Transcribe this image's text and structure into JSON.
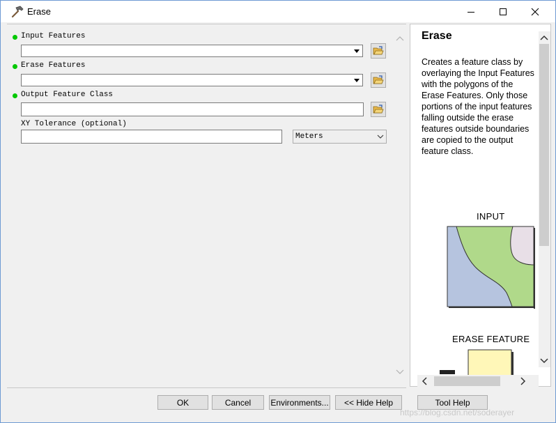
{
  "window": {
    "title": "Erase"
  },
  "params": {
    "input_features": {
      "label": "Input Features",
      "value": ""
    },
    "erase_features": {
      "label": "Erase Features",
      "value": ""
    },
    "output_feature_class": {
      "label": "Output Feature Class",
      "value": ""
    },
    "xy_tolerance": {
      "label": "XY Tolerance (optional)",
      "value": "",
      "units": "Meters"
    }
  },
  "help": {
    "title": "Erase",
    "description": "Creates a feature class by overlaying the Input Features with the polygons of the Erase Features. Only those portions of the input features falling outside the erase features outside boundaries are copied to the output feature class.",
    "figure_input_label": "INPUT",
    "figure_erase_label": "ERASE FEATURE"
  },
  "buttons": {
    "ok": "OK",
    "cancel": "Cancel",
    "environments": "Environments...",
    "hide_help": "<< Hide Help",
    "tool_help": "Tool Help"
  },
  "watermark": "https://blog.csdn.net/soderayer",
  "colors": {
    "required_dot": "#00c800",
    "map_green": "#b0d98a",
    "map_blue": "#b6c4df",
    "map_pink": "#e8dfe7",
    "erase_yellow": "#fff7b8"
  }
}
